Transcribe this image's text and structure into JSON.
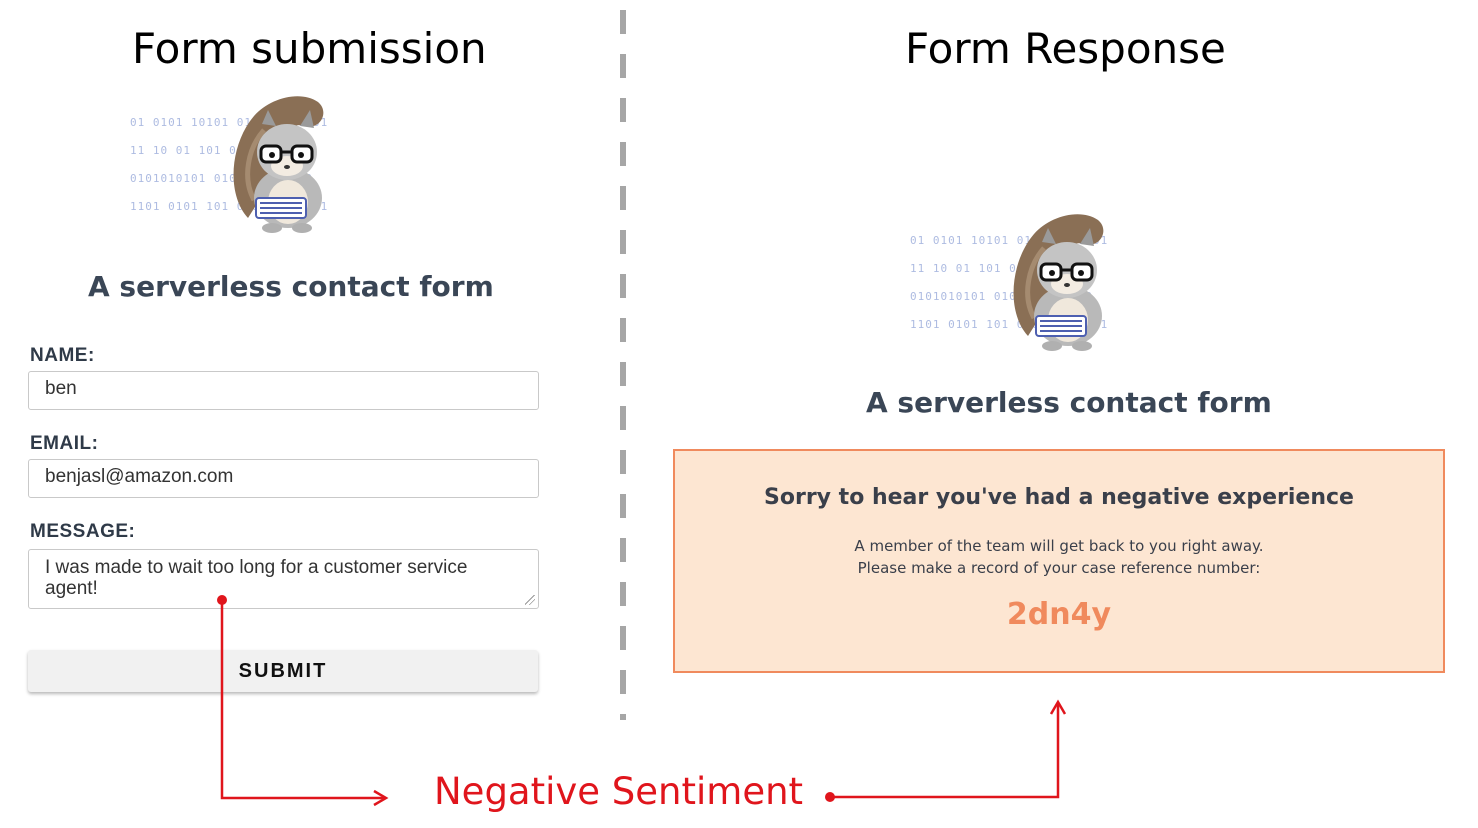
{
  "headings": {
    "left": "Form submission",
    "right": "Form Response"
  },
  "mascot": {
    "binary_rows": [
      "01 0101 10101   01010 010 01",
      "11 10 01 101    0101011101",
      "0101010101     010101110 010",
      "1101 0101 101   0101011 0101"
    ]
  },
  "form": {
    "title": "A serverless contact form",
    "name_label": "NAME:",
    "name_value": "ben",
    "email_label": "EMAIL:",
    "email_value": "benjasl@amazon.com",
    "message_label": "MESSAGE:",
    "message_value": "I was made to wait too long for a customer service agent!",
    "submit_label": "SUBMIT"
  },
  "response": {
    "title": "A serverless contact form",
    "heading": "Sorry to hear you've had a negative experience",
    "line1": "A member of the team will get back to you right away.",
    "line2": "Please make a record of your case reference number:",
    "reference_number": "2dn4y"
  },
  "annotation": {
    "label": "Negative Sentiment"
  },
  "colors": {
    "accent": "#f08a5d",
    "panel_background": "#fde6d2",
    "annotation_red": "#e0151c",
    "title_slate": "#3a4656"
  }
}
